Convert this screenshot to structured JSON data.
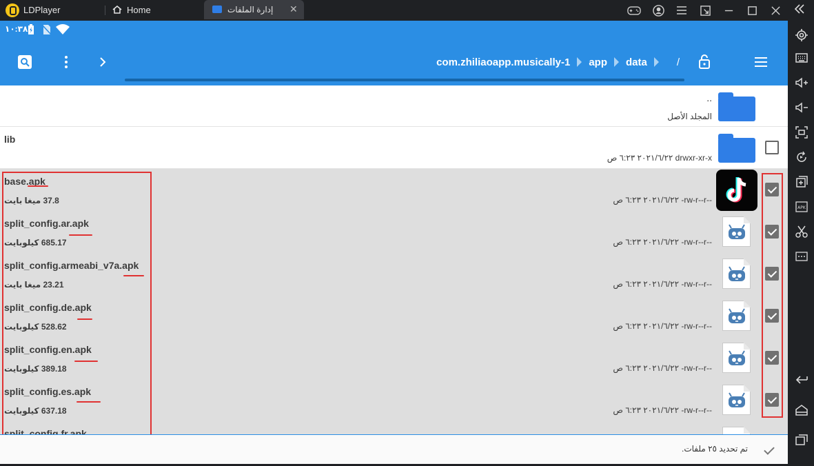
{
  "titlebar": {
    "app_name": "LDPlayer",
    "tabs": [
      {
        "label": "Home"
      },
      {
        "label": "إدارة الملفات",
        "close": "✕"
      }
    ]
  },
  "statusbar": {
    "time": "١٠:٣٨"
  },
  "appbar": {
    "breadcrumb": [
      "com.zhiliaoapp.musically-1",
      "app",
      "data"
    ],
    "root": "/"
  },
  "list": {
    "parent": {
      "dots": "..",
      "label": "المجلد الأصل"
    },
    "dir": {
      "name": "lib",
      "meta": "٢٠٢١/٦/٢٢ ٦:٢٣ ص   drwxr-xr-x"
    },
    "files": [
      {
        "name": "base.apk",
        "size": "37.8 ميغا بايت",
        "meta": "٢٠٢١/٦/٢٢ ٦:٢٣ ص   -rw-r--r--",
        "icon": "tiktok-icon",
        "checked": true
      },
      {
        "name": "split_config.ar.apk",
        "size": "685.17 كيلوبايت",
        "meta": "٢٠٢١/٦/٢٢ ٦:٢٣ ص   -rw-r--r--",
        "icon": "apk-file-icon",
        "checked": true
      },
      {
        "name": "split_config.armeabi_v7a.apk",
        "size": "23.21 ميغا بايت",
        "meta": "٢٠٢١/٦/٢٢ ٦:٢٣ ص   -rw-r--r--",
        "icon": "apk-file-icon",
        "checked": true
      },
      {
        "name": "split_config.de.apk",
        "size": "528.62 كيلوبايت",
        "meta": "٢٠٢١/٦/٢٢ ٦:٢٣ ص   -rw-r--r--",
        "icon": "apk-file-icon",
        "checked": true
      },
      {
        "name": "split_config.en.apk",
        "size": "389.18 كيلوبايت",
        "meta": "٢٠٢١/٦/٢٢ ٦:٢٣ ص   -rw-r--r--",
        "icon": "apk-file-icon",
        "checked": true
      },
      {
        "name": "split_config.es.apk",
        "size": "637.18 كيلوبايت",
        "meta": "٢٠٢١/٦/٢٢ ٦:٢٣ ص   -rw-r--r--",
        "icon": "apk-file-icon",
        "checked": true
      },
      {
        "name": "split_config.fr.apk",
        "icon": "apk-file-icon"
      }
    ]
  },
  "bottombar": {
    "message": "تم تحديد ٢٥ ملفات."
  },
  "colors": {
    "accent": "#2b8ee4",
    "annotation": "#e03232",
    "selected_row": "#dedede"
  }
}
